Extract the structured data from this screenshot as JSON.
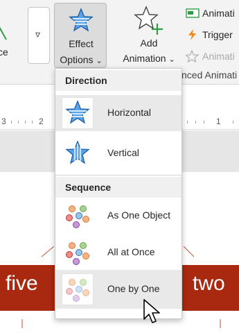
{
  "ribbon": {
    "left_partial_label": "ce",
    "effect_options": {
      "line1": "Effect",
      "line2": "Options",
      "chevron": "⌄"
    },
    "add_animation": {
      "line1": "Add",
      "line2": "Animation",
      "chevron": "⌄"
    },
    "side_items": [
      {
        "label": "Animati",
        "icon": "animation-pane-icon",
        "enabled": true
      },
      {
        "label": "Trigger",
        "icon": "lightning-icon",
        "enabled": true
      },
      {
        "label": "Animati",
        "icon": "animation-painter-icon",
        "enabled": false
      }
    ],
    "group_label_partial": "nced Animati",
    "more_button_glyph": "▿"
  },
  "ruler": {
    "labels": [
      "3",
      "2",
      "1"
    ]
  },
  "slide": {
    "left_word": "five",
    "right_word": "two",
    "banner_color": "#a8290f"
  },
  "dropdown": {
    "direction_header": "Direction",
    "direction_items": [
      {
        "label": "Horizontal",
        "icon": "star-horizontal-icon",
        "selected": true
      },
      {
        "label": "Vertical",
        "icon": "star-vertical-icon",
        "selected": false
      }
    ],
    "sequence_header": "Sequence",
    "sequence_items": [
      {
        "label": "As One Object",
        "icon": "dots-one-object-icon",
        "selected": false
      },
      {
        "label": "All at Once",
        "icon": "dots-all-at-once-icon",
        "selected": false
      },
      {
        "label": "One by One",
        "icon": "dots-one-by-one-icon",
        "selected": true
      }
    ]
  },
  "colors": {
    "accent_blue": "#2b7bd0",
    "star_light_blue": "#8cc2ee",
    "add_plus_green": "#2e9e44",
    "trigger_orange": "#f08a1c"
  }
}
